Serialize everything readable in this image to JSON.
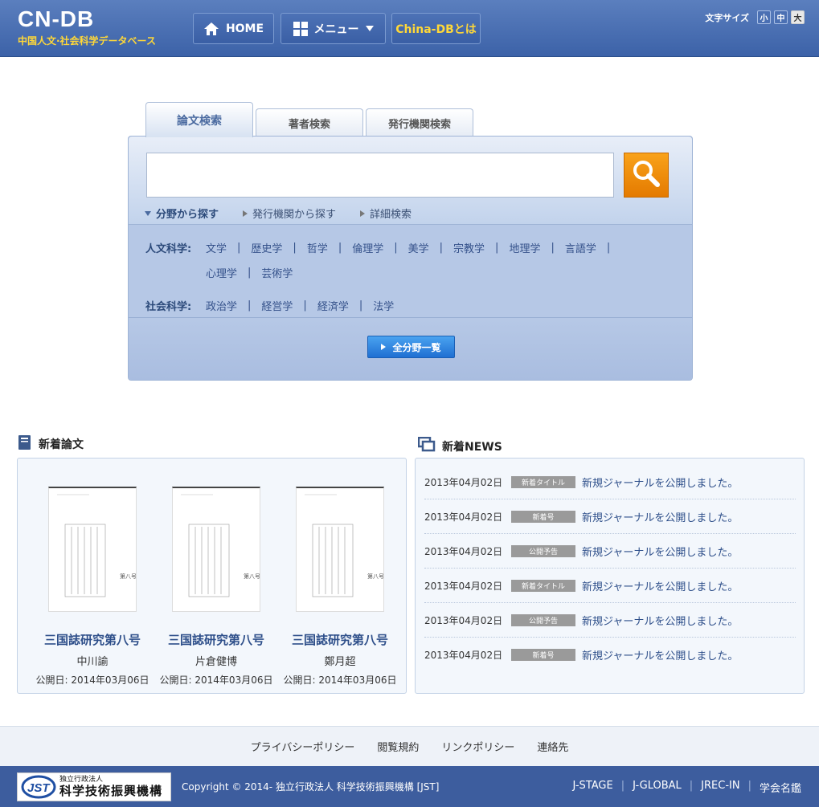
{
  "header": {
    "logo_main": "CN-DB",
    "logo_sub": "中国人文·社会科学データベース",
    "nav": {
      "home": "HOME",
      "menu": "メニュー",
      "about": "China-DBとは"
    },
    "font_size": {
      "label": "文字サイズ",
      "small": "小",
      "medium": "中",
      "large": "大"
    }
  },
  "search": {
    "tabs": [
      {
        "label": "論文検索"
      },
      {
        "label": "著者検索"
      },
      {
        "label": "発行機関検索"
      }
    ],
    "input_value": "",
    "sub_links": [
      {
        "label": "分野から探す"
      },
      {
        "label": "発行機関から探す"
      },
      {
        "label": "詳細検索"
      }
    ],
    "humanities": {
      "label": "人文科学:",
      "items": [
        "文学",
        "歴史学",
        "哲学",
        "倫理学",
        "美学",
        "宗教学",
        "地理学",
        "言語学",
        "心理学",
        "芸術学"
      ]
    },
    "social": {
      "label": "社会科学:",
      "items": [
        "政治学",
        "経営学",
        "経済学",
        "法学"
      ]
    },
    "all_fields_button": "全分野一覧"
  },
  "new_papers": {
    "title": "新着論文",
    "items": [
      {
        "title": "三国誌研究第八号",
        "author": "中川諭",
        "date": "公開日: 2014年03月06日"
      },
      {
        "title": "三国誌研究第八号",
        "author": "片倉健博",
        "date": "公開日: 2014年03月06日"
      },
      {
        "title": "三国誌研究第八号",
        "author": "鄭月超",
        "date": "公開日: 2014年03月06日"
      }
    ]
  },
  "news": {
    "title": "新着NEWS",
    "items": [
      {
        "date": "2013年04月02日",
        "badge": "新着タイトル",
        "text": "新規ジャーナルを公開しました。"
      },
      {
        "date": "2013年04月02日",
        "badge": "新着号",
        "text": "新規ジャーナルを公開しました。"
      },
      {
        "date": "2013年04月02日",
        "badge": "公開予告",
        "text": "新規ジャーナルを公開しました。"
      },
      {
        "date": "2013年04月02日",
        "badge": "新着タイトル",
        "text": "新規ジャーナルを公開しました。"
      },
      {
        "date": "2013年04月02日",
        "badge": "公開予告",
        "text": "新規ジャーナルを公開しました。"
      },
      {
        "date": "2013年04月02日",
        "badge": "新着号",
        "text": "新規ジャーナルを公開しました。"
      }
    ]
  },
  "footer": {
    "links": [
      "プライバシーポリシー",
      "閲覧規約",
      "リンクポリシー",
      "連絡先"
    ],
    "jst_small": "独立行政法人",
    "jst_big": "科学技術振興機構",
    "copyright": "Copyright © 2014- 独立行政法人 科学技術振興機構 [JST]",
    "external_links": [
      "J-STAGE",
      "J-GLOBAL",
      "JREC-IN",
      "学会名鑑"
    ]
  },
  "colors": {
    "header": "#3c62a8",
    "accent_yellow": "#ffd838",
    "search_orange": "#f09010",
    "panel": "#b6c8e6"
  }
}
